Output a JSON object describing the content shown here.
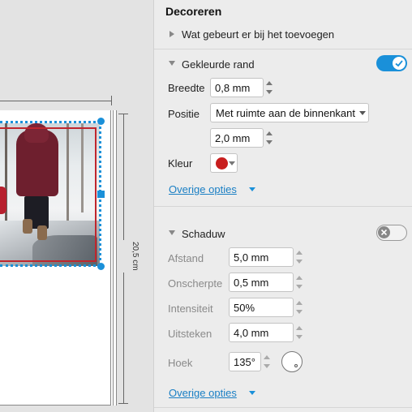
{
  "panel": {
    "title": "Decoreren",
    "what_happens": "Wat gebeurt er bij het toevoegen",
    "colored_border": {
      "label": "Gekleurde rand",
      "toggle_on": true,
      "width_label": "Breedte",
      "width_value": "0,8 mm",
      "position_label": "Positie",
      "position_value": "Met ruimte aan de binnenkant",
      "spacing_value": "2,0 mm",
      "color_label": "Kleur",
      "color": "#c81e1e",
      "more_options": "Overige opties"
    },
    "shadow": {
      "label": "Schaduw",
      "toggle_on": false,
      "distance_label": "Afstand",
      "distance_value": "5,0 mm",
      "blur_label": "Onscherpte",
      "blur_value": "0,5 mm",
      "intensity_label": "Intensiteit",
      "intensity_value": "50%",
      "spread_label": "Uitsteken",
      "spread_value": "4,0 mm",
      "angle_label": "Hoek",
      "angle_value": "135°",
      "more_options": "Overige opties"
    }
  },
  "canvas": {
    "dimension_label": "20,5 cm"
  },
  "colors": {
    "accent": "#1a90d9",
    "border_red": "#c0262d"
  }
}
